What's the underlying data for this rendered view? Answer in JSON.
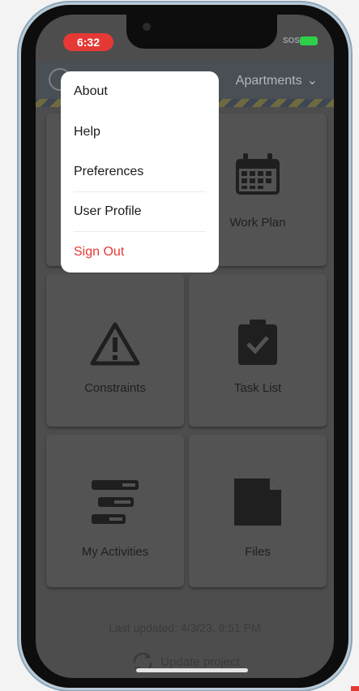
{
  "status_bar": {
    "time": "6:32",
    "network": "SOS"
  },
  "header": {
    "project_label": "Apartments"
  },
  "menu": {
    "items": [
      {
        "label": "About"
      },
      {
        "label": "Help"
      },
      {
        "label": "Preferences"
      },
      {
        "label": "User Profile"
      },
      {
        "label": "Sign Out"
      }
    ]
  },
  "tiles": [
    {
      "label": "Work Plan",
      "icon": "calendar-icon"
    },
    {
      "label": "Constraints",
      "icon": "warning-icon"
    },
    {
      "label": "Task List",
      "icon": "clipboard-check-icon"
    },
    {
      "label": "My Activities",
      "icon": "gantt-icon"
    },
    {
      "label": "Files",
      "icon": "file-icon"
    }
  ],
  "footer": {
    "last_updated": "Last updated: 4/3/23, 9:51 PM",
    "update_label": "Update project"
  },
  "colors": {
    "accent_red": "#e53935",
    "dim_background": "#4d4d4d",
    "menu_background": "#ffffff"
  }
}
